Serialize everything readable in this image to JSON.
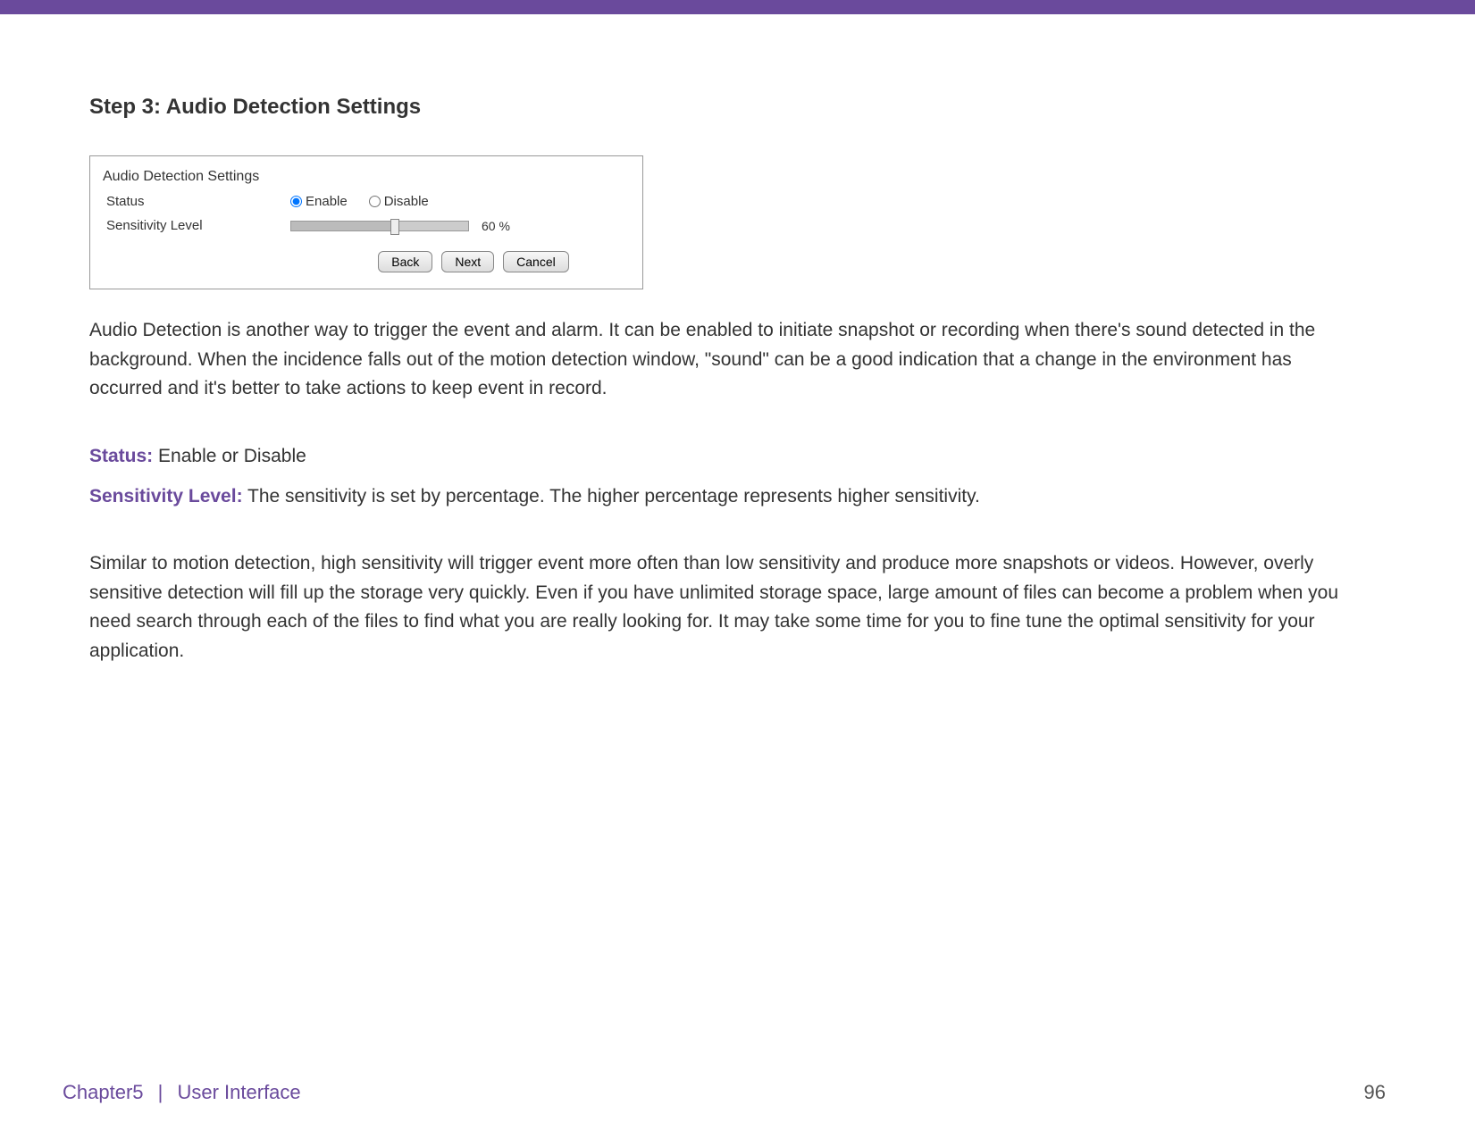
{
  "title": "Step 3: Audio Detection Settings",
  "panel": {
    "heading": "Audio Detection Settings",
    "rows": {
      "status_label": "Status",
      "enable_label": "Enable",
      "disable_label": "Disable",
      "enable_checked": true,
      "sensitivity_label": "Sensitivity Level",
      "sensitivity_value": "60",
      "sensitivity_unit": "%"
    },
    "buttons": {
      "back": "Back",
      "next": "Next",
      "cancel": "Cancel"
    }
  },
  "paragraphs": {
    "p1": "Audio Detection is another way to trigger the event and alarm. It can be enabled to initiate snapshot or recording when there's sound detected in the background. When the incidence falls out of the motion detection window, \"sound\" can be a good indication that a change in the environment has occurred and it's better to take actions to keep event in record.",
    "p2": "Similar to motion detection, high sensitivity will trigger event more often than low sensitivity and produce more snapshots or videos. However, overly sensitive detection will fill up the storage very quickly. Even if you have unlimited storage space, large amount of files can become a problem when you need search through each of the files to find what you are really looking for. It may take some time for you to fine tune the optimal sensitivity for your application."
  },
  "definitions": {
    "status_term": "Status:",
    "status_desc": " Enable or Disable",
    "sensitivity_term": "Sensitivity Level:",
    "sensitivity_desc": " The sensitivity is set by percentage. The higher percentage represents higher sensitivity."
  },
  "footer": {
    "chapter": "Chapter5",
    "divider": "|",
    "section": "User Interface",
    "page": "96"
  }
}
